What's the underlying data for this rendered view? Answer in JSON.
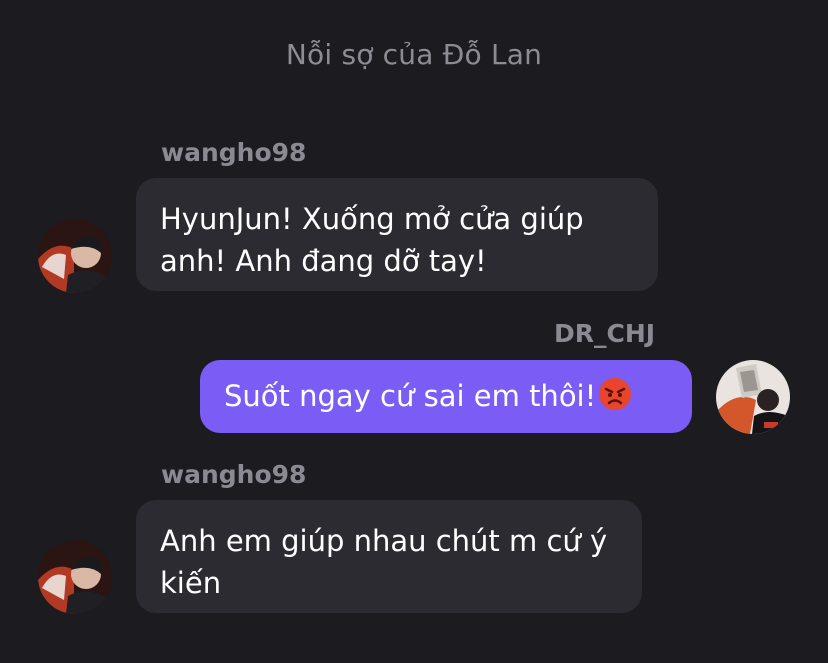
{
  "header": {
    "title": "Nỗi sợ của Đỗ Lan"
  },
  "messages": [
    {
      "sender": "wangho98",
      "text": "HyunJun! Xuống mở cửa giúp anh! Anh đang dỡ tay!",
      "direction": "incoming"
    },
    {
      "sender": "DR_CHJ",
      "text": "Suốt ngay cứ sai em thôi!",
      "emoji": "angry-face-emoji",
      "direction": "outgoing"
    },
    {
      "sender": "wangho98",
      "text": "Anh em giúp nhau chút m cứ ý kiến",
      "direction": "incoming"
    }
  ],
  "colors": {
    "background": "#1c1b20",
    "incoming_bubble": "#2c2b31",
    "outgoing_bubble": "#7b5cf5",
    "secondary_text": "#8b8a92"
  }
}
